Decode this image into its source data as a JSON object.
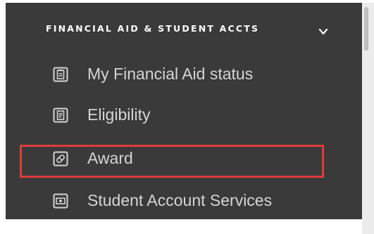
{
  "sidebar": {
    "section_title": "FINANCIAL AID & STUDENT ACCTS",
    "items": [
      {
        "label": "My Financial Aid status",
        "icon": "clipboard-icon"
      },
      {
        "label": "Eligibility",
        "icon": "document-icon"
      },
      {
        "label": "Award",
        "icon": "ticket-icon"
      },
      {
        "label": "Student Account Services",
        "icon": "money-icon"
      }
    ]
  },
  "colors": {
    "panel_bg": "#3a3a3a",
    "text": "#d4d4d4",
    "highlight": "#e03a3a"
  }
}
